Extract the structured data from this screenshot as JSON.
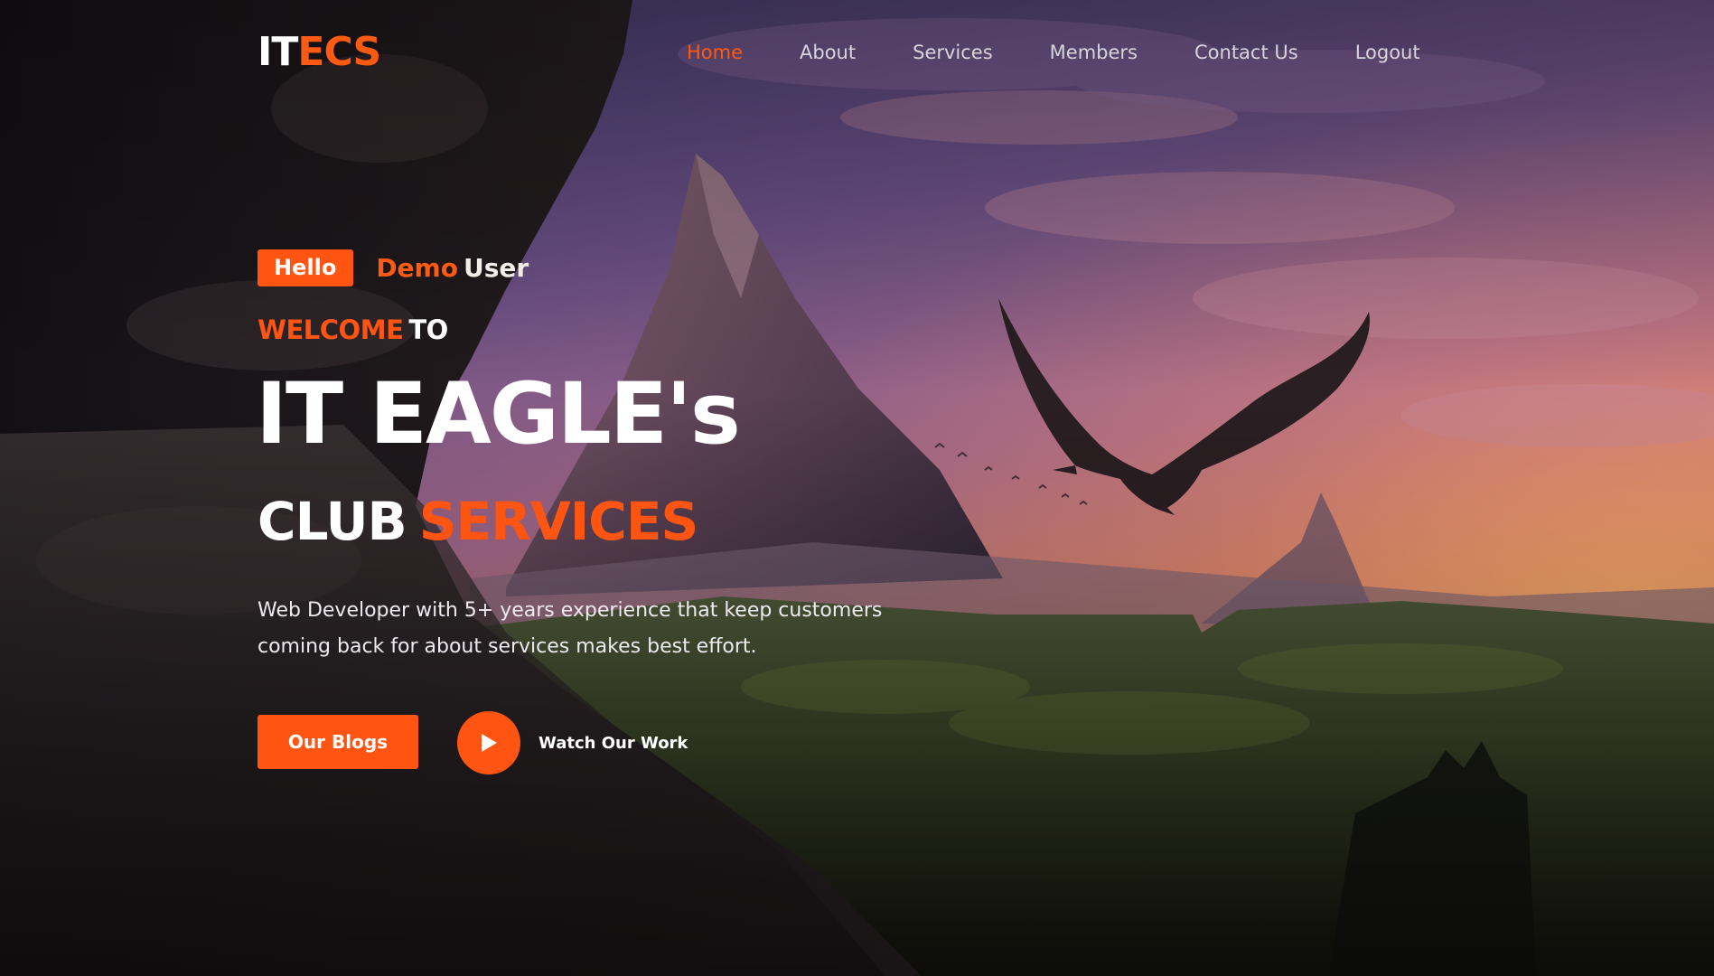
{
  "brand": {
    "logo_part1": "IT",
    "logo_part2": "ECS",
    "accent_color": "#ff5412"
  },
  "nav": {
    "items": [
      {
        "label": "Home",
        "active": true
      },
      {
        "label": "About",
        "active": false
      },
      {
        "label": "Services",
        "active": false
      },
      {
        "label": "Members",
        "active": false
      },
      {
        "label": "Contact Us",
        "active": false
      },
      {
        "label": "Logout",
        "active": false
      }
    ]
  },
  "hero": {
    "hello_badge": "Hello",
    "user_first": "Demo",
    "user_last": "User",
    "welcome_word": "WELCOME",
    "to_word": "TO",
    "headline": "IT EAGLE's",
    "sub_club": "CLUB",
    "sub_services": "SERVICES",
    "description": "Web Developer with 5+ years experience that keep customers coming back for about services makes best effort.",
    "primary_button": "Our Blogs",
    "watch_label": "Watch Our Work",
    "play_icon": "play-icon"
  }
}
